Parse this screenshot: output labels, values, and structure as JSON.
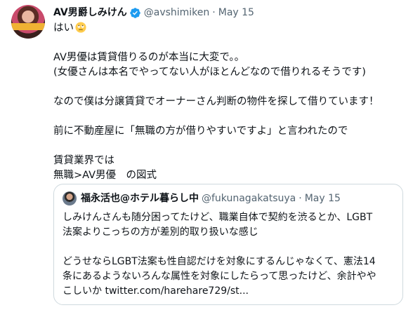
{
  "tweet": {
    "display_name": "AV男爵しみけん",
    "handle": "@avshimiken",
    "separator": "·",
    "date": "May 15",
    "emoji": "rolling-eyes-emoji",
    "lines": [
      "はい",
      "",
      "AV男優は賃貸借りるのが本当に大変で。。",
      "(女優さんは本名でやってない人がほとんどなので借りれるそうです)",
      "",
      "なので僕は分譲賃貸でオーナーさん判断の物件を探して借りています！",
      "",
      "前に不動産屋に「無職の方が借りやすいですよ」と言われたので",
      "",
      "賃貸業界では",
      "無職>AV男優　の図式"
    ]
  },
  "quote": {
    "display_name": "福永活也@ホテル暮らし中",
    "handle": "@fukunagakatsuya",
    "separator": "·",
    "date": "May 15",
    "lines": [
      "しみけんさんも随分困ってたけど、職業自体で契約を渋るとか、LGBT",
      "法案よりこっちの方が差別的取り扱いな感じ",
      "",
      "どうせならLGBT法案も性自認だけを対象にするんじゃなくて、憲法14",
      "条にあるようないろんな属性を対象にしたらって思ったけど、余計やや",
      "こしいか twitter.com/harehare729/st..."
    ]
  },
  "colors": {
    "text": "#0f1419",
    "secondary": "#536471",
    "verified": "#1d9bf0",
    "border": "#cfd9de"
  }
}
